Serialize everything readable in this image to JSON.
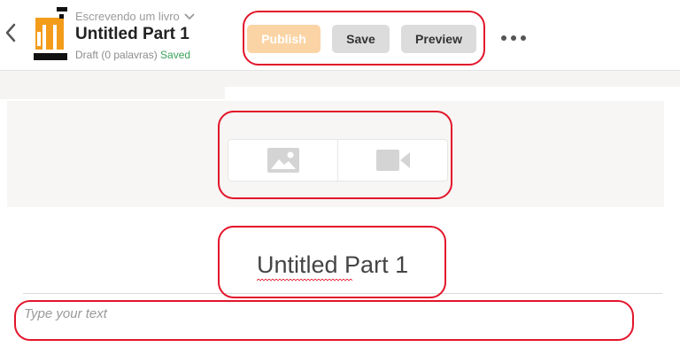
{
  "header": {
    "story_title": "Escrevendo um livro",
    "part_title": "Untitled Part 1",
    "status_text": "Draft (0 palavras)",
    "saved_text": "Saved"
  },
  "toolbar": {
    "publish_label": "Publish",
    "save_label": "Save",
    "preview_label": "Preview"
  },
  "media": {
    "image_icon": "image-icon",
    "video_icon": "video-camera-icon"
  },
  "editor": {
    "title": "Untitled Part 1",
    "body_placeholder": "Type your text"
  },
  "colors": {
    "publish_bg": "#fbd4a6",
    "button_gray": "#dcdcdc",
    "saved_green": "#3aa35a",
    "cover_orange": "#f39c1b",
    "highlight_red": "#e2152b"
  }
}
